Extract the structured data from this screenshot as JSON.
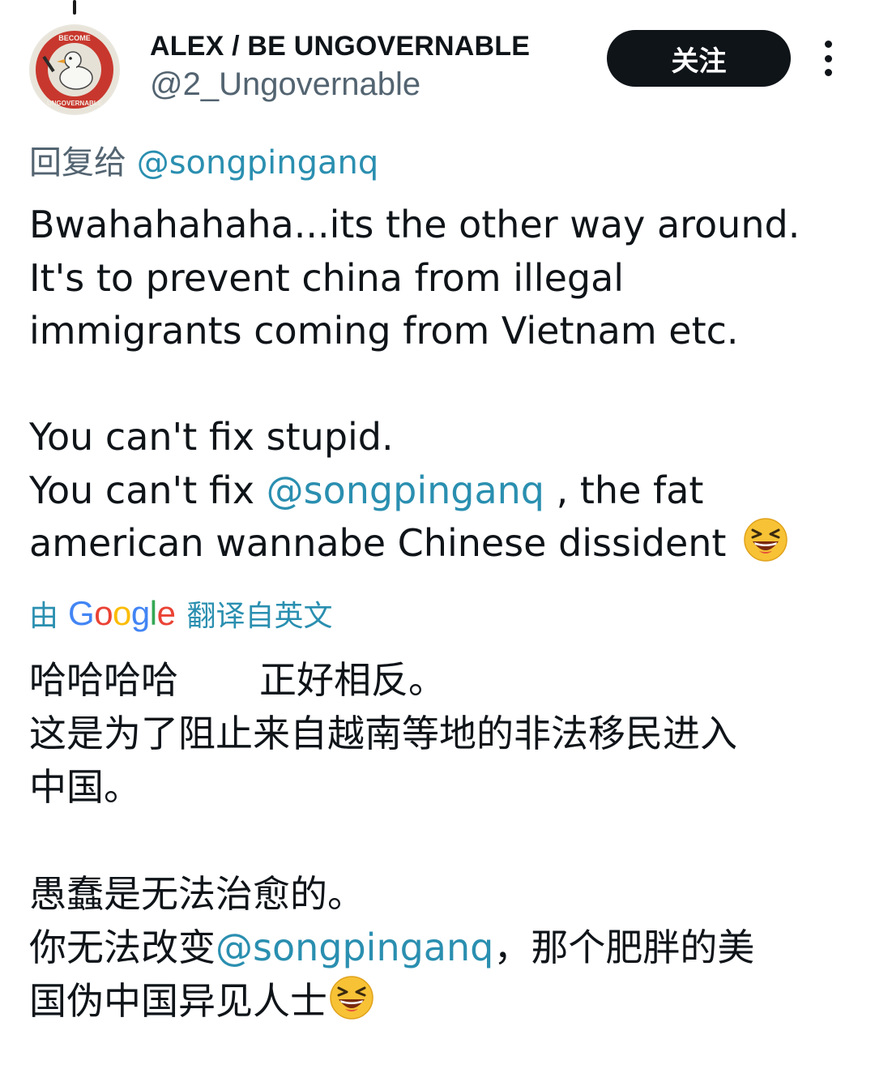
{
  "author": {
    "display_name": "ALEX / BE UNGOVERNABLE",
    "handle": "@2_Ungovernable",
    "avatar": {
      "icon": "goose-badge-avatar",
      "ring_text_top": "BECOME",
      "ring_text_bottom": "UNGOVERNABLE"
    }
  },
  "actions": {
    "follow_label": "关注",
    "more_icon": "more-vertical-icon"
  },
  "reply_to": {
    "prefix": "回复给 ",
    "mention": "@songpinganq"
  },
  "tweet": {
    "line1": "Bwahahahaha...its the other way around.",
    "line2": "It's to prevent china from illegal",
    "line3": "immigrants coming from Vietnam etc.",
    "line4": "You can't fix stupid.",
    "line5_prefix": "You can't fix ",
    "line5_mention": "@songpinganq",
    "line5_suffix": " , the fat",
    "line6": "american wannabe Chinese dissident",
    "emoji": "grinning-squinting-face-emoji"
  },
  "translation_bar": {
    "by": "由",
    "provider": "Google",
    "suffix": "翻译自英文"
  },
  "translation": {
    "line1_a": "哈哈哈哈",
    "line1_b": "正好相反。",
    "line2": "这是为了阻止来自越南等地的非法移民进入",
    "line3": "中国。",
    "line4": "愚蠢是无法治愈的。",
    "line5_prefix": "你无法改变",
    "line5_mention": "@songpinganq",
    "line5_suffix": "，那个肥胖的美",
    "line6": "国伪中国异见人士",
    "emoji": "grinning-squinting-face-emoji"
  },
  "colors": {
    "text": "#0f1419",
    "secondary": "#536471",
    "mention": "#1d9bf0",
    "translate_link": "#2a8fb0",
    "follow_bg": "#0f1419"
  }
}
